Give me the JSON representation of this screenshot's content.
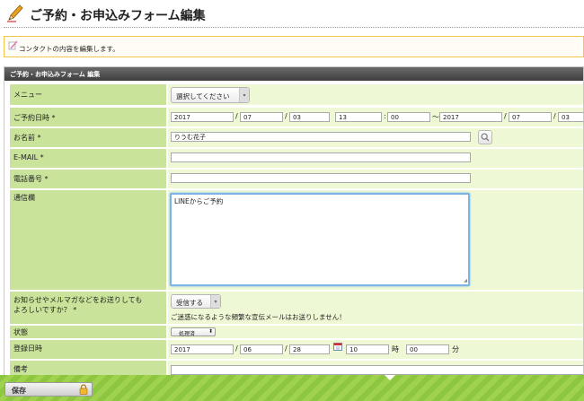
{
  "page": {
    "title": "ご予約・お申込みフォーム編集",
    "info": "コンタクトの内容を編集します。"
  },
  "section": {
    "title": "ご予約・お申込みフォーム 編集"
  },
  "form": {
    "menu": {
      "label": "メニュー",
      "select": "選択してください"
    },
    "date": {
      "label": "ご予約日時 *",
      "start": {
        "year": "2017",
        "month": "07",
        "day": "03",
        "hour": "13",
        "minute": "00"
      },
      "range_sep": "～",
      "end": {
        "year": "2017",
        "month": "07",
        "day": "03"
      }
    },
    "name": {
      "label": "お名前 *",
      "value": "りうむ花子"
    },
    "email": {
      "label": "E-MAIL *",
      "value": ""
    },
    "phone": {
      "label": "電話番号 *",
      "value": ""
    },
    "message": {
      "label": "通信欄",
      "value": "LINEからご予約"
    },
    "newsletter": {
      "label_line1": "お知らせやメルマガなどをお送りしても",
      "label_line2": "よろしいですか？ *",
      "select": "受信する",
      "note": "ご迷惑になるような頻繁な宣伝メールはお送りしません！"
    },
    "status": {
      "label": "状態",
      "select": "処理済"
    },
    "registered": {
      "label": "登録日時",
      "year": "2017",
      "month": "06",
      "day": "28",
      "hour": "10",
      "hour_unit": "時",
      "minute": "00",
      "minute_unit": "分"
    },
    "remarks": {
      "label": "備考",
      "value": ""
    }
  },
  "footer": {
    "save_label": "保存"
  },
  "separators": {
    "slash": "/",
    "colon": ":"
  },
  "colors": {
    "label_bg": "#c9e49a",
    "value_bg": "#eef8d4",
    "footer_green": "#8dc63f",
    "section_header": "#4a4a4a",
    "focus_blue": "#7cb4e8"
  },
  "icons": {
    "title": "pencil-icon",
    "info": "memo-icon",
    "search": "magnifier-icon",
    "calendar": "calendar-icon",
    "save": "lock-icon"
  }
}
